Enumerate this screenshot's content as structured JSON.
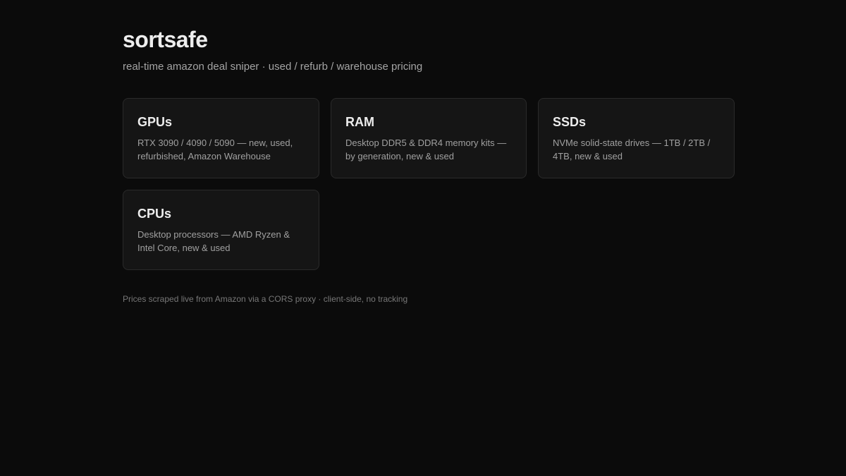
{
  "header": {
    "title": "sortsafe",
    "subtitle": "real-time amazon deal sniper · used / refurb / warehouse pricing"
  },
  "categories": [
    {
      "title": "GPUs",
      "description": "RTX 3090 / 4090 / 5090 — new, used, refurbished, Amazon Warehouse"
    },
    {
      "title": "RAM",
      "description": "Desktop DDR5 & DDR4 memory kits — by generation, new & used"
    },
    {
      "title": "SSDs",
      "description": "NVMe solid-state drives — 1TB / 2TB / 4TB, new & used"
    },
    {
      "title": "CPUs",
      "description": "Desktop processors — AMD Ryzen & Intel Core, new & used"
    }
  ],
  "footer": {
    "text": "Prices scraped live from Amazon via a CORS proxy · client-side, no tracking"
  }
}
